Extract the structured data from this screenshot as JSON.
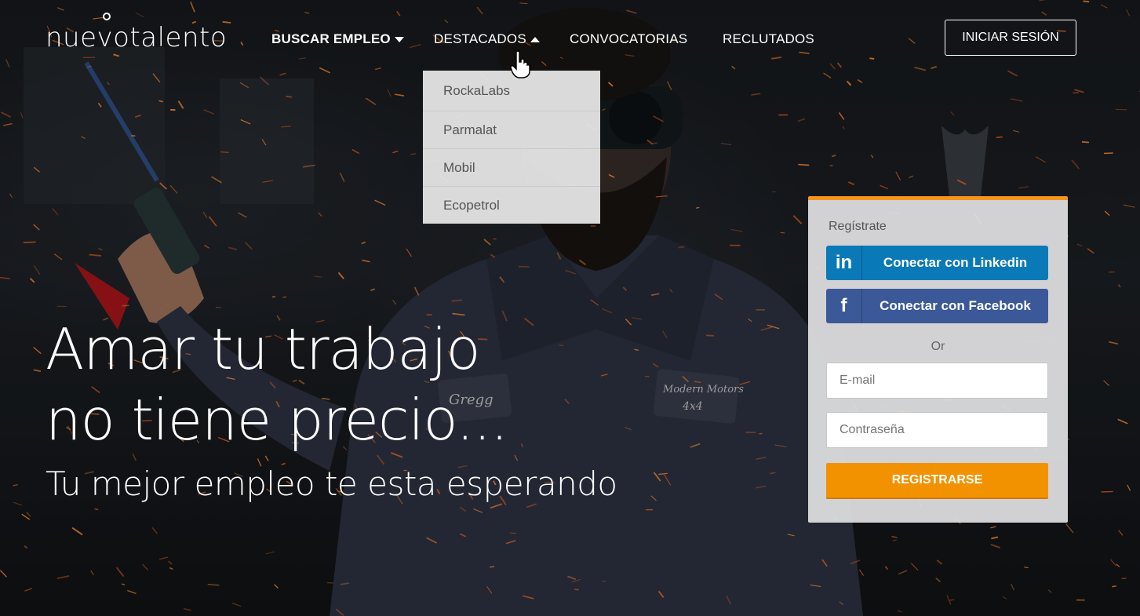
{
  "brand": {
    "logo": "nuevotalento"
  },
  "nav": {
    "items": [
      {
        "label": "BUSCAR EMPLEO"
      },
      {
        "label": "DESTACADOS"
      },
      {
        "label": "CONVOCATORIAS"
      },
      {
        "label": "RECLUTADOS"
      }
    ],
    "login_label": "INICIAR SESIÓN"
  },
  "dropdown": {
    "items": [
      "RockaLabs",
      "Parmalat",
      "Mobil",
      "Ecopetrol"
    ]
  },
  "hero": {
    "headline_line1": "Amar tu trabajo",
    "headline_line2": "no tiene precio...",
    "subheadline": "Tu mejor empleo te esta esperando"
  },
  "register": {
    "title": "Regístrate",
    "linkedin_label": "Conectar con Linkedin",
    "linkedin_icon": "in",
    "facebook_label": "Conectar con Facebook",
    "facebook_icon": "f",
    "or_label": "Or",
    "email_placeholder": "E-mail",
    "password_placeholder": "Contraseña",
    "submit_label": "REGISTRARSE"
  },
  "colors": {
    "accent": "#f39200",
    "linkedin": "#0a79b7",
    "facebook": "#3b5998"
  }
}
